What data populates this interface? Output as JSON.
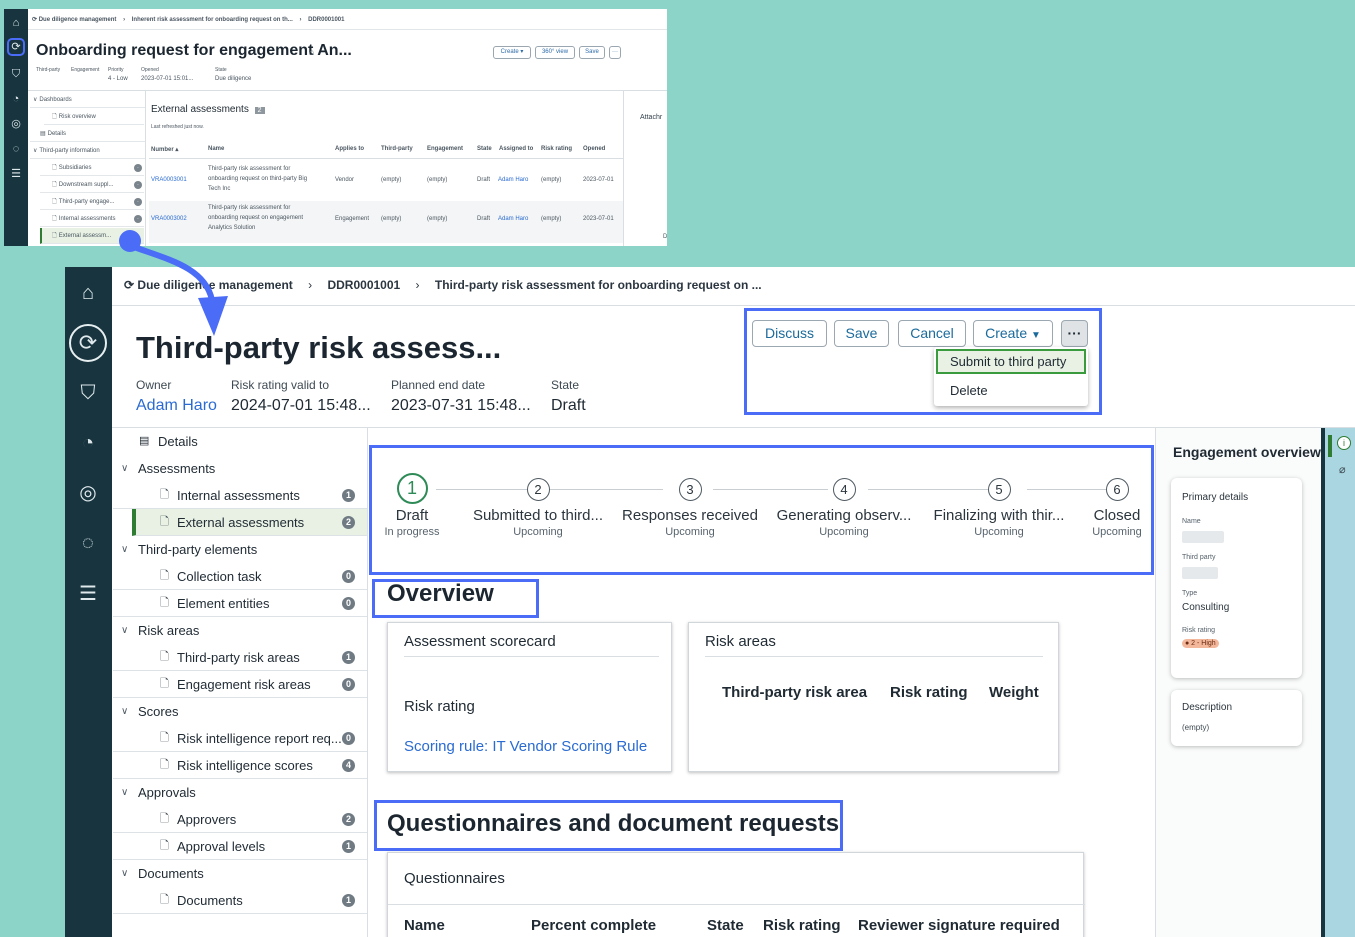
{
  "top": {
    "breadcrumbs": [
      "Due diligence management",
      "Inherent risk assessment for onboarding request on th...",
      "DDR0001001"
    ],
    "title": "Onboarding request for engagement An...",
    "buttons": {
      "create": "Create ▾",
      "view360": "360° view",
      "save": "Save",
      "more": "···"
    },
    "fields": [
      {
        "label": "Third-party",
        "value": ""
      },
      {
        "label": "Engagement",
        "value": ""
      },
      {
        "label": "Priority",
        "value": "4 - Low"
      },
      {
        "label": "Opened",
        "value": "2023-07-01 15:01..."
      },
      {
        "label": "State",
        "value": "Due diligence"
      }
    ],
    "nav": {
      "dashboards": "Dashboards",
      "risk_overview": "Risk overview",
      "details": "Details",
      "third_party_info": "Third-party information",
      "subsidiaries": "Subsidiaries",
      "downstream": "Downstream suppl...",
      "engagements": "Third-party engage...",
      "internal": "Internal assessments",
      "external": "External assessm..."
    },
    "section": {
      "title": "External assessments",
      "count": "2",
      "refreshed": "Last refreshed just now."
    },
    "columns": [
      "Number ▴",
      "Name",
      "Applies to",
      "Third-party",
      "Engagement",
      "State",
      "Assigned to",
      "Risk rating",
      "Opened"
    ],
    "rows": [
      {
        "number": "VRA0003001",
        "name_lines": [
          "Third-party risk assessment for",
          "onboarding request on third-party Big",
          "Tech Inc"
        ],
        "applies_to": "Vendor",
        "third_party": "(empty)",
        "engagement": "(empty)",
        "state": "Draft",
        "assigned_to": "Adam Haro",
        "risk_rating": "(empty)",
        "opened": "2023-07-01"
      },
      {
        "number": "VRA0003002",
        "name_lines": [
          "Third-party risk assessment for",
          "onboarding request on engagement",
          "Analytics Solution"
        ],
        "applies_to": "Engagement",
        "third_party": "(empty)",
        "engagement": "(empty)",
        "state": "Draft",
        "assigned_to": "Adam Haro",
        "risk_rating": "(empty)",
        "opened": "2023-07-01"
      }
    ],
    "attach_label": "Attachr",
    "edge_letter": "D"
  },
  "main": {
    "breadcrumbs": [
      "Due diligence management",
      "DDR0001001",
      "Third-party risk assessment for onboarding request on ..."
    ],
    "title": "Third-party risk assess...",
    "fields": [
      {
        "label": "Owner",
        "value": "Adam Haro"
      },
      {
        "label": "Risk rating valid to",
        "value": "2024-07-01 15:48..."
      },
      {
        "label": "Planned end date",
        "value": "2023-07-31 15:48..."
      },
      {
        "label": "State",
        "value": "Draft"
      }
    ],
    "buttons": {
      "discuss": "Discuss",
      "save": "Save",
      "cancel": "Cancel",
      "create": "Create",
      "more": "···"
    },
    "menu": {
      "submit": "Submit to third party",
      "delete": "Delete"
    },
    "nav": {
      "details": "Details",
      "groups": [
        {
          "label": "Assessments",
          "items": [
            {
              "label": "Internal assessments",
              "count": "1"
            },
            {
              "label": "External assessments",
              "count": "2"
            }
          ]
        },
        {
          "label": "Third-party elements",
          "items": [
            {
              "label": "Collection task",
              "count": "0"
            },
            {
              "label": "Element entities",
              "count": "0"
            }
          ]
        },
        {
          "label": "Risk areas",
          "items": [
            {
              "label": "Third-party risk areas",
              "count": "1"
            },
            {
              "label": "Engagement risk areas",
              "count": "0"
            }
          ]
        },
        {
          "label": "Scores",
          "items": [
            {
              "label": "Risk intelligence report req...",
              "count": "0"
            },
            {
              "label": "Risk intelligence scores",
              "count": "4"
            }
          ]
        },
        {
          "label": "Approvals",
          "items": [
            {
              "label": "Approvers",
              "count": "2"
            },
            {
              "label": "Approval levels",
              "count": "1"
            }
          ]
        },
        {
          "label": "Documents",
          "items": [
            {
              "label": "Documents",
              "count": "1"
            }
          ]
        }
      ]
    },
    "steps": [
      {
        "num": "1",
        "title": "Draft",
        "sub": "In progress"
      },
      {
        "num": "2",
        "title": "Submitted to third...",
        "sub": "Upcoming"
      },
      {
        "num": "3",
        "title": "Responses received",
        "sub": "Upcoming"
      },
      {
        "num": "4",
        "title": "Generating observ...",
        "sub": "Upcoming"
      },
      {
        "num": "5",
        "title": "Finalizing with thir...",
        "sub": "Upcoming"
      },
      {
        "num": "6",
        "title": "Closed",
        "sub": "Upcoming"
      }
    ],
    "overview": {
      "heading": "Overview",
      "scorecard": {
        "title": "Assessment scorecard",
        "risk_rating_label": "Risk rating",
        "scoring_rule": "Scoring rule: IT Vendor Scoring Rule"
      },
      "risk_areas": {
        "title": "Risk areas",
        "columns": [
          "Third-party risk area",
          "Risk rating",
          "Weight"
        ]
      }
    },
    "questionnaires": {
      "heading": "Questionnaires and document requests",
      "card_title": "Questionnaires",
      "columns": [
        "Name",
        "Percent complete",
        "State",
        "Risk rating",
        "Reviewer signature required"
      ]
    },
    "engagement_overview": {
      "title": "Engagement overview",
      "primary_details": "Primary details",
      "name_label": "Name",
      "third_party_label": "Third party",
      "type_label": "Type",
      "type_value": "Consulting",
      "risk_rating_label": "Risk rating",
      "risk_rating_value": "● 2 - High",
      "description_label": "Description",
      "description_value": "(empty)"
    }
  },
  "colors": {
    "highlight": "#4a6cf7",
    "rail": "#17343f",
    "link": "#2a6bd1",
    "background": "#8dd4c8",
    "current_step": "#2e8b57"
  }
}
